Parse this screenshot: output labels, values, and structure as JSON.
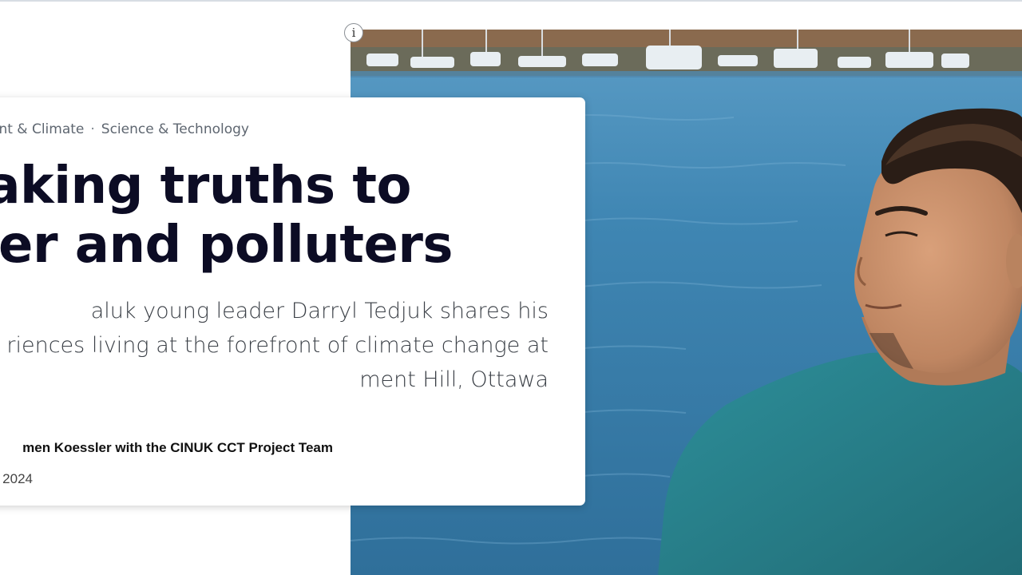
{
  "info_button": {
    "label": "i"
  },
  "article": {
    "topics": [
      "ent & Climate",
      "Science & Technology"
    ],
    "topic_separator": "·",
    "title_lines": [
      "eaking truths to",
      "wer and polluters"
    ],
    "subtitle_lines": [
      "aluk young leader Darryl Tedjuk shares his",
      "riences living at the forefront of climate change at",
      "ment Hill, Ottawa"
    ],
    "byline": "men Koessler with the CINUK CCT Project Team",
    "date": "2024"
  },
  "hero_image": {
    "icon": "hero-photo",
    "colors": {
      "water": "#3f7ea9",
      "shirt": "#2f8a95",
      "skin": "#c9926b",
      "hair": "#2a1d16"
    }
  }
}
